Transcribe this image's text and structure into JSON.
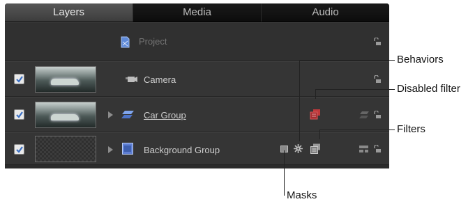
{
  "tabs": [
    "Layers",
    "Media",
    "Audio"
  ],
  "rows": {
    "project": "Project",
    "camera": "Camera",
    "car_group": "Car Group",
    "background_group": "Background Group"
  },
  "callouts": {
    "behaviors": "Behaviors",
    "disabled_filter": "Disabled filter",
    "filters": "Filters",
    "masks": "Masks"
  },
  "colors": {
    "panel": "#2b2b2b",
    "row": "#353535",
    "checkbox_check": "#3a6fc4",
    "group_icon": "#6b8fd6",
    "disabled_filter": "#c0393b"
  }
}
